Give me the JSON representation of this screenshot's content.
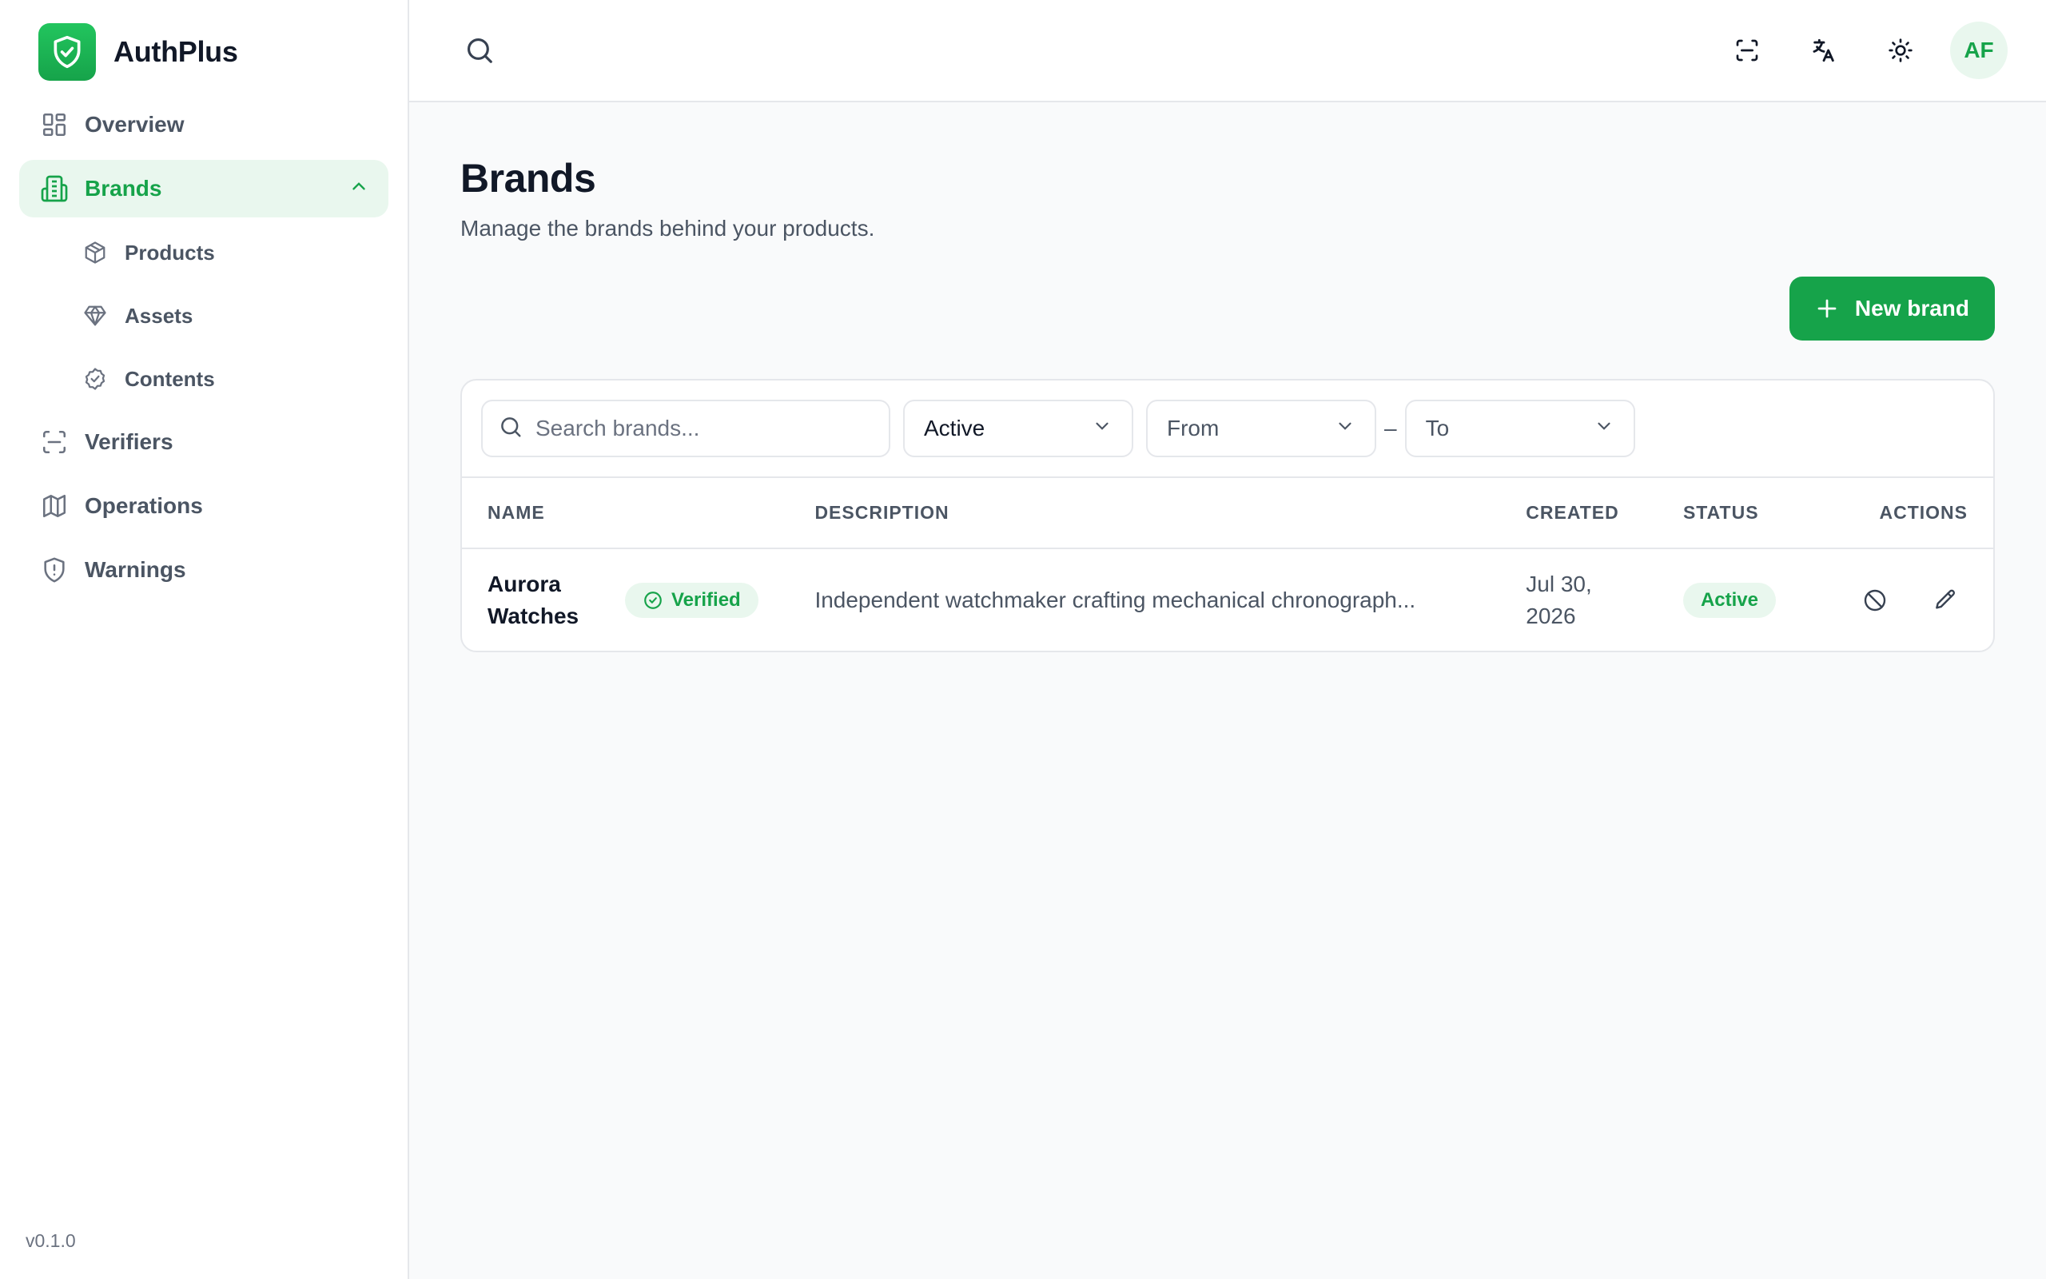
{
  "app": {
    "name": "AuthPlus",
    "version": "v0.1.0",
    "accent": "#16a34a"
  },
  "sidebar": {
    "items": [
      {
        "label": "Overview",
        "icon": "layout-dashboard-icon"
      },
      {
        "label": "Brands",
        "icon": "building-icon",
        "active": true,
        "children": [
          {
            "label": "Products",
            "icon": "package-icon"
          },
          {
            "label": "Assets",
            "icon": "gem-icon"
          },
          {
            "label": "Contents",
            "icon": "badge-check-icon"
          }
        ]
      },
      {
        "label": "Verifiers",
        "icon": "scan-icon"
      },
      {
        "label": "Operations",
        "icon": "map-icon"
      },
      {
        "label": "Warnings",
        "icon": "shield-alert-icon"
      }
    ]
  },
  "topbar": {
    "avatar_initials": "AF",
    "icons": [
      "search-icon",
      "scan-icon",
      "translate-icon",
      "sun-icon"
    ]
  },
  "page": {
    "title": "Brands",
    "subtitle": "Manage the brands behind your products.",
    "new_button": "New brand"
  },
  "filters": {
    "search_placeholder": "Search brands...",
    "status_value": "Active",
    "from_value": "From",
    "to_value": "To",
    "separator": "–"
  },
  "table": {
    "columns": [
      "NAME",
      "DESCRIPTION",
      "CREATED",
      "STATUS",
      "ACTIONS"
    ],
    "rows": [
      {
        "name_line1": "Aurora",
        "name_line2": "Watches",
        "badge": "Verified",
        "description": "Independent watchmaker crafting mechanical chronograph...",
        "created_line1": "Jul 30,",
        "created_line2": "2026",
        "status": "Active"
      }
    ]
  }
}
